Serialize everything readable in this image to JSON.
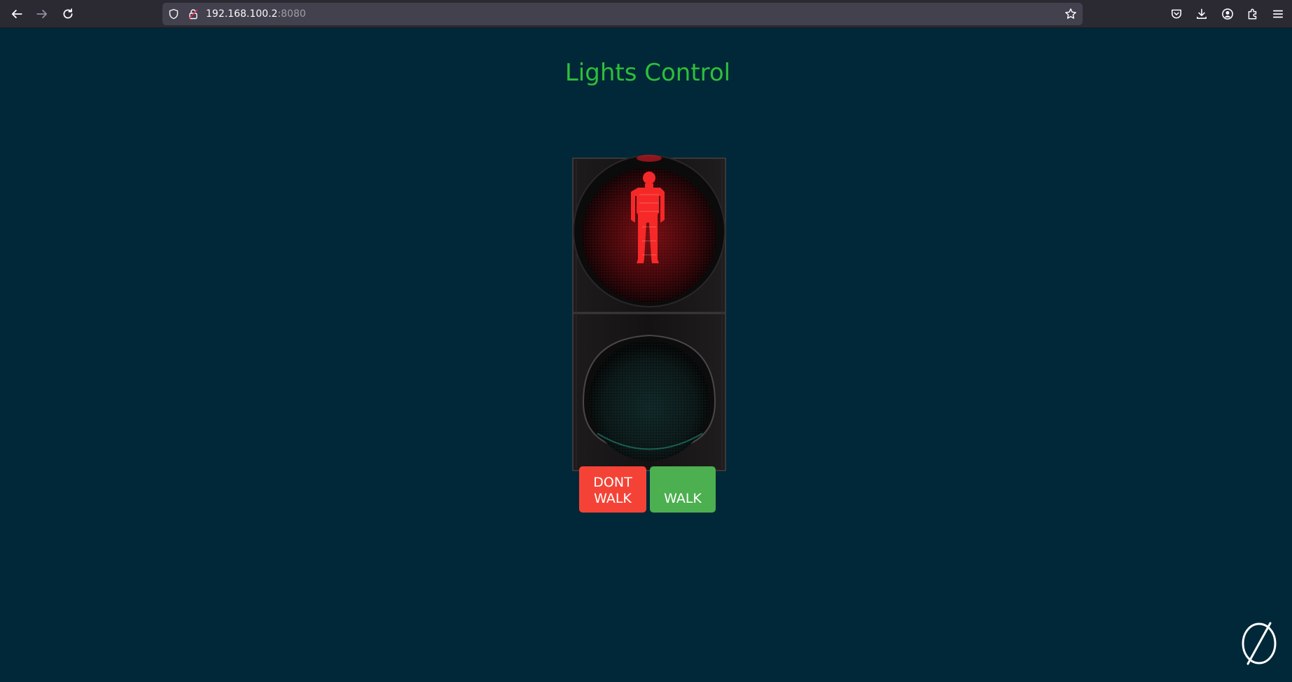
{
  "browser": {
    "url_host": "192.168.100.2",
    "url_port": ":8080",
    "icons": {
      "back": "back-arrow-icon",
      "forward": "forward-arrow-icon",
      "reload": "reload-icon",
      "shield": "shield-icon",
      "lock": "lock-icon",
      "bookmark": "star-icon",
      "pocket": "pocket-icon",
      "downloads": "download-icon",
      "account": "account-icon",
      "extensions": "extensions-icon",
      "menu": "hamburger-menu-icon"
    }
  },
  "page": {
    "title": "Lights Control",
    "buttons": {
      "dont_walk_line1": "DONT",
      "dont_walk_line2": "WALK",
      "walk": "WALK"
    },
    "colors": {
      "background": "#002838",
      "title": "#2dbf3a",
      "dont_walk_button": "#f44336",
      "walk_button": "#4caf50"
    },
    "signal_state": "dont-walk"
  }
}
